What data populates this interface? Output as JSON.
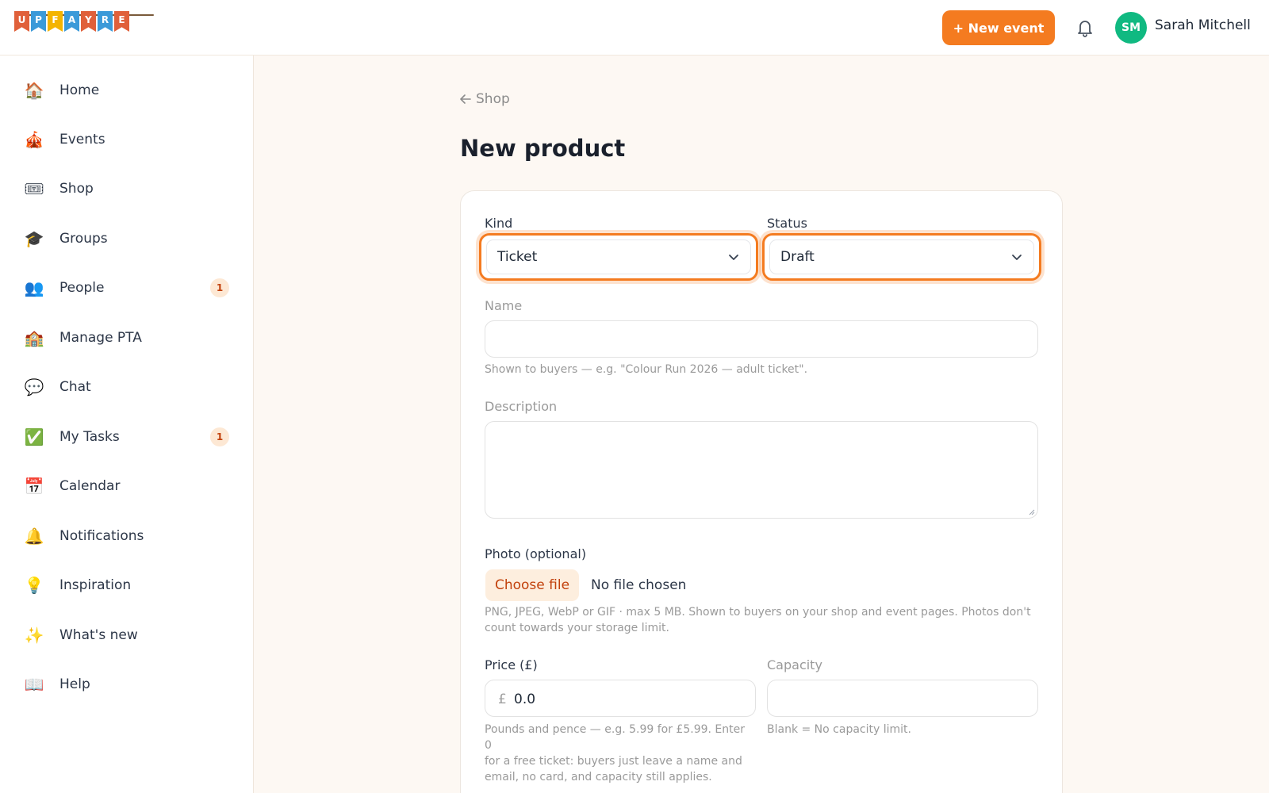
{
  "header": {
    "logo_letters": [
      "U",
      "P",
      "F",
      "A",
      "Y",
      "R",
      "E"
    ],
    "logo_colors": [
      "#e0603a",
      "#3b9ad9",
      "#f4b400",
      "#3b9ad9",
      "#e0603a",
      "#3b9ad9",
      "#e0603a"
    ],
    "new_event_label": "+ New event",
    "bell_icon": "bell-icon",
    "avatar_initials": "SM",
    "user_name": "Sarah Mitchell"
  },
  "sidebar": {
    "items": [
      {
        "label": "Home",
        "icon": "🏠",
        "badge": ""
      },
      {
        "label": "Events",
        "icon": "🎪",
        "badge": ""
      },
      {
        "label": "Shop",
        "icon": "🎟",
        "badge": ""
      },
      {
        "label": "Groups",
        "icon": "🎓",
        "badge": ""
      },
      {
        "label": "People",
        "icon": "👥",
        "badge": "1"
      },
      {
        "label": "Manage PTA",
        "icon": "🏫",
        "badge": ""
      },
      {
        "label": "Chat",
        "icon": "💬",
        "badge": ""
      },
      {
        "label": "My Tasks",
        "icon": "✅",
        "badge": "1"
      },
      {
        "label": "Calendar",
        "icon": "📅",
        "badge": ""
      },
      {
        "label": "Notifications",
        "icon": "🔔",
        "badge": ""
      },
      {
        "label": "Inspiration",
        "icon": "💡",
        "badge": ""
      },
      {
        "label": "What's new",
        "icon": "✨",
        "badge": ""
      },
      {
        "label": "Help",
        "icon": "📖",
        "badge": ""
      }
    ]
  },
  "main": {
    "breadcrumb": "Shop",
    "title": "New product",
    "form": {
      "kind_label": "Kind",
      "kind_value": "Ticket",
      "status_label": "Status",
      "status_value": "Draft",
      "name_label": "Name",
      "name_value": "",
      "name_hint": "Shown to buyers — e.g. \"Colour Run 2026 — adult ticket\".",
      "description_label": "Description",
      "description_value": "",
      "photo_label": "Photo (optional)",
      "choose_file_label": "Choose file",
      "file_status": "No file chosen",
      "photo_hint_line1": "PNG, JPEG, WebP or GIF · max 5 MB. Shown to buyers on your shop and event pages. Photos don't",
      "photo_hint_line2": "count towards your storage limit.",
      "price_label": "Price (£)",
      "currency_symbol": "£",
      "price_value": "0.0",
      "price_hint_line1": "Pounds and pence — e.g. 5.99 for £5.99. Enter 0",
      "price_hint_line2": "for a free ticket: buyers just leave a name and",
      "price_hint_line3": "email, no card, and capacity still applies.",
      "capacity_label": "Capacity",
      "capacity_value": "",
      "capacity_hint": "Blank = No capacity limit."
    }
  },
  "colors": {
    "accent": "#f47b20",
    "avatar": "#10b981",
    "background": "#fdf8f3"
  }
}
